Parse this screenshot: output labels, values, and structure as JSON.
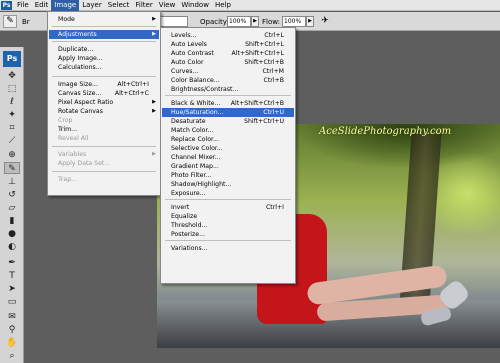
{
  "menubar": {
    "logo": "Ps",
    "items": [
      "File",
      "Edit",
      "Image",
      "Layer",
      "Select",
      "Filter",
      "View",
      "Window",
      "Help"
    ]
  },
  "options": {
    "brush_label": "Br",
    "opacity_label": "Opacity:",
    "opacity_value": "100%",
    "flow_label": "Flow:",
    "flow_value": "100%"
  },
  "toolbox": {
    "logo": "Ps"
  },
  "image_menu": {
    "items": [
      {
        "label": "Mode",
        "shortcut": "",
        "submenu": true,
        "disabled": false,
        "highlight": false
      },
      {
        "label": "Adjustments",
        "shortcut": "",
        "submenu": true,
        "disabled": false,
        "highlight": true
      },
      {
        "label": "Duplicate...",
        "shortcut": "",
        "submenu": false,
        "disabled": false,
        "highlight": false
      },
      {
        "label": "Apply Image...",
        "shortcut": "",
        "submenu": false,
        "disabled": false,
        "highlight": false
      },
      {
        "label": "Calculations...",
        "shortcut": "",
        "submenu": false,
        "disabled": false,
        "highlight": false
      },
      {
        "label": "Image Size...",
        "shortcut": "Alt+Ctrl+I",
        "submenu": false,
        "disabled": false,
        "highlight": false
      },
      {
        "label": "Canvas Size...",
        "shortcut": "Alt+Ctrl+C",
        "submenu": false,
        "disabled": false,
        "highlight": false
      },
      {
        "label": "Pixel Aspect Ratio",
        "shortcut": "",
        "submenu": true,
        "disabled": false,
        "highlight": false
      },
      {
        "label": "Rotate Canvas",
        "shortcut": "",
        "submenu": true,
        "disabled": false,
        "highlight": false
      },
      {
        "label": "Crop",
        "shortcut": "",
        "submenu": false,
        "disabled": true,
        "highlight": false
      },
      {
        "label": "Trim...",
        "shortcut": "",
        "submenu": false,
        "disabled": false,
        "highlight": false
      },
      {
        "label": "Reveal All",
        "shortcut": "",
        "submenu": false,
        "disabled": true,
        "highlight": false
      },
      {
        "label": "Variables",
        "shortcut": "",
        "submenu": true,
        "disabled": true,
        "highlight": false
      },
      {
        "label": "Apply Data Set...",
        "shortcut": "",
        "submenu": false,
        "disabled": true,
        "highlight": false
      },
      {
        "label": "Trap...",
        "shortcut": "",
        "submenu": false,
        "disabled": true,
        "highlight": false
      }
    ]
  },
  "adjust_menu": {
    "items": [
      {
        "label": "Levels...",
        "shortcut": "Ctrl+L",
        "highlight": false
      },
      {
        "label": "Auto Levels",
        "shortcut": "Shift+Ctrl+L",
        "highlight": false
      },
      {
        "label": "Auto Contrast",
        "shortcut": "Alt+Shift+Ctrl+L",
        "highlight": false
      },
      {
        "label": "Auto Color",
        "shortcut": "Shift+Ctrl+B",
        "highlight": false
      },
      {
        "label": "Curves...",
        "shortcut": "Ctrl+M",
        "highlight": false
      },
      {
        "label": "Color Balance...",
        "shortcut": "Ctrl+B",
        "highlight": false
      },
      {
        "label": "Brightness/Contrast...",
        "shortcut": "",
        "highlight": false
      },
      {
        "label": "Black & White...",
        "shortcut": "Alt+Shift+Ctrl+B",
        "highlight": false
      },
      {
        "label": "Hue/Saturation...",
        "shortcut": "Ctrl+U",
        "highlight": true
      },
      {
        "label": "Desaturate",
        "shortcut": "Shift+Ctrl+U",
        "highlight": false
      },
      {
        "label": "Match Color...",
        "shortcut": "",
        "highlight": false
      },
      {
        "label": "Replace Color...",
        "shortcut": "",
        "highlight": false
      },
      {
        "label": "Selective Color...",
        "shortcut": "",
        "highlight": false
      },
      {
        "label": "Channel Mixer...",
        "shortcut": "",
        "highlight": false
      },
      {
        "label": "Gradient Map...",
        "shortcut": "",
        "highlight": false
      },
      {
        "label": "Photo Filter...",
        "shortcut": "",
        "highlight": false
      },
      {
        "label": "Shadow/Highlight...",
        "shortcut": "",
        "highlight": false
      },
      {
        "label": "Exposure...",
        "shortcut": "",
        "highlight": false
      },
      {
        "label": "Invert",
        "shortcut": "Ctrl+I",
        "highlight": false
      },
      {
        "label": "Equalize",
        "shortcut": "",
        "highlight": false
      },
      {
        "label": "Threshold...",
        "shortcut": "",
        "highlight": false
      },
      {
        "label": "Posterize...",
        "shortcut": "",
        "highlight": false
      },
      {
        "label": "Variations...",
        "shortcut": "",
        "highlight": false
      }
    ]
  },
  "photo": {
    "watermark": "AceSlidePhotography.com"
  },
  "colors": {
    "highlight": "#316ac5",
    "menu_bg": "#f2f2f2",
    "dress": "#c4151b"
  }
}
